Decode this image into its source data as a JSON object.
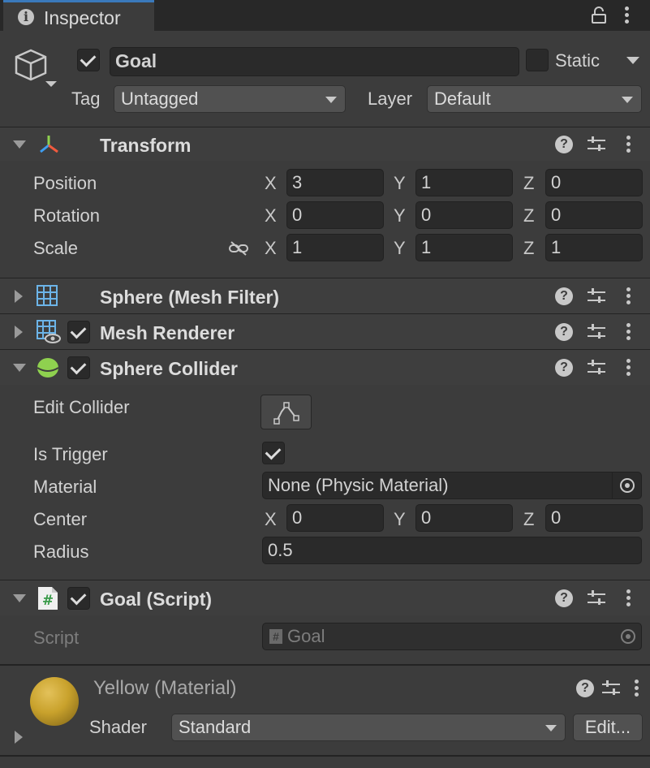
{
  "tab": {
    "title": "Inspector"
  },
  "gameobject": {
    "active": true,
    "name": "Goal",
    "static_label": "Static",
    "static_checked": false,
    "tag_label": "Tag",
    "tag_value": "Untagged",
    "layer_label": "Layer",
    "layer_value": "Default"
  },
  "transform": {
    "title": "Transform",
    "position": {
      "label": "Position",
      "x": "3",
      "y": "1",
      "z": "0"
    },
    "rotation": {
      "label": "Rotation",
      "x": "0",
      "y": "0",
      "z": "0"
    },
    "scale": {
      "label": "Scale",
      "x": "1",
      "y": "1",
      "z": "1"
    }
  },
  "axes": {
    "x": "X",
    "y": "Y",
    "z": "Z"
  },
  "mesh_filter": {
    "title": "Sphere (Mesh Filter)"
  },
  "mesh_renderer": {
    "title": "Mesh Renderer",
    "enabled": true
  },
  "sphere_collider": {
    "title": "Sphere Collider",
    "enabled": true,
    "edit_collider_label": "Edit Collider",
    "is_trigger_label": "Is Trigger",
    "is_trigger": true,
    "material_label": "Material",
    "material_value": "None (Physic Material)",
    "center_label": "Center",
    "center": {
      "x": "0",
      "y": "0",
      "z": "0"
    },
    "radius_label": "Radius",
    "radius": "0.5"
  },
  "goal_script": {
    "title": "Goal (Script)",
    "enabled": true,
    "script_label": "Script",
    "script_value": "Goal"
  },
  "material": {
    "name": "Yellow",
    "suffix": "(Material)",
    "shader_label": "Shader",
    "shader_value": "Standard",
    "edit_label": "Edit..."
  },
  "colors": {
    "accent": "#3a79bb",
    "material_yellow": "#c9a22c",
    "collider_green": "#8fd14f"
  }
}
